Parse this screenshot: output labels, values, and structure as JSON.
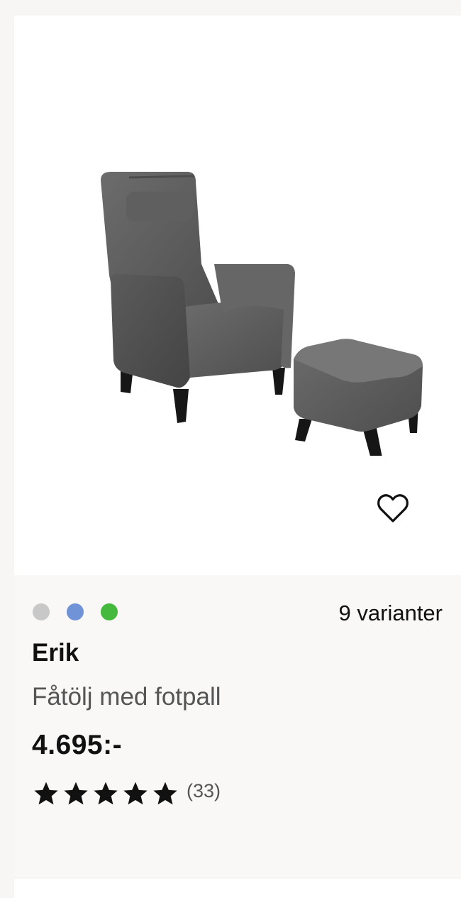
{
  "product": {
    "name": "Erik",
    "description": "Fåtölj med fotpall",
    "price": "4.695:-",
    "variants_label": "9 varianter",
    "review_count": "(33)",
    "rating": 5,
    "image_alt": "Erik fåtölj med fotpall",
    "swatches": [
      {
        "color": "#c8c8c8"
      },
      {
        "color": "#6f93d6"
      },
      {
        "color": "#45b83e"
      }
    ]
  },
  "icons": {
    "favorite": "heart-outline-icon",
    "star": "star-filled-icon"
  },
  "colors": {
    "page_background": "#f7f6f4",
    "image_background": "#ffffff",
    "text": "#111111",
    "muted_text": "#555555"
  }
}
